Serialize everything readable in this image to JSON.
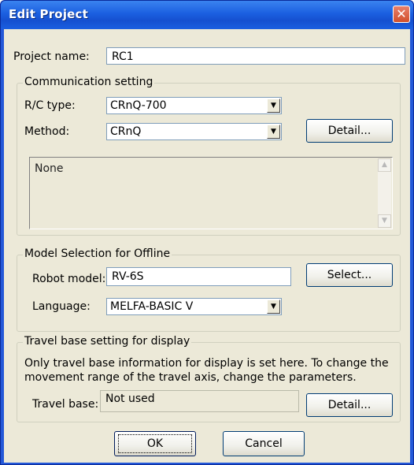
{
  "window": {
    "title": "Edit Project",
    "close_glyph": "✕"
  },
  "project": {
    "label": "Project name:",
    "value": "RC1"
  },
  "communication": {
    "group_title": "Communication setting",
    "rc_type": {
      "label": "R/C type:",
      "value": "CRnQ-700"
    },
    "method": {
      "label": "Method:",
      "value": "CRnQ"
    },
    "detail_button": "Detail...",
    "info_text": "None"
  },
  "model": {
    "group_title": "Model Selection for Offline",
    "robot": {
      "label": "Robot model:",
      "value": "RV-6S"
    },
    "select_button": "Select...",
    "language": {
      "label": "Language:",
      "value": "MELFA-BASIC V"
    }
  },
  "travel": {
    "group_title": "Travel base setting for display",
    "description_line1": "Only travel base information for display is set here. To change the",
    "description_line2": "movement range of the travel axis, change the parameters.",
    "label": "Travel base:",
    "value": "Not used",
    "detail_button": "Detail..."
  },
  "footer": {
    "ok": "OK",
    "cancel": "Cancel"
  }
}
